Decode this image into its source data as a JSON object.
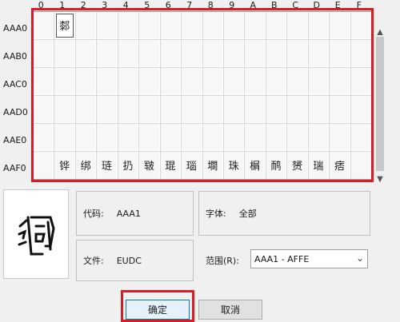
{
  "grid": {
    "column_headers": [
      "0",
      "1",
      "2",
      "3",
      "4",
      "5",
      "6",
      "7",
      "8",
      "9",
      "A",
      "B",
      "C",
      "D",
      "E",
      "F"
    ],
    "row_labels": [
      "AAA0",
      "AAB0",
      "AAC0",
      "AAD0",
      "AAE0",
      "AAF0"
    ],
    "selected_char": "䣛",
    "last_row_chars": [
      "",
      "铧",
      "绑",
      "琏",
      "扔",
      "皲",
      "琨",
      "瑙",
      "墹",
      "珠",
      "榍",
      "鸸",
      "赟",
      "瑞",
      "痞",
      ""
    ]
  },
  "details": {
    "code_label": "代码:",
    "code_value": "AAA1",
    "font_label": "字体:",
    "font_value": "全部",
    "file_label": "文件:",
    "file_value": "EUDC",
    "range_label": "范围(R):",
    "range_value": "AAA1 - AFFE"
  },
  "buttons": {
    "ok": "确定",
    "cancel": "取消"
  },
  "scrollbar": {
    "up_icon": "▲",
    "down_icon": "▼"
  },
  "colors": {
    "highlight": "#e01a22",
    "default_button_border": "#0078d7"
  }
}
